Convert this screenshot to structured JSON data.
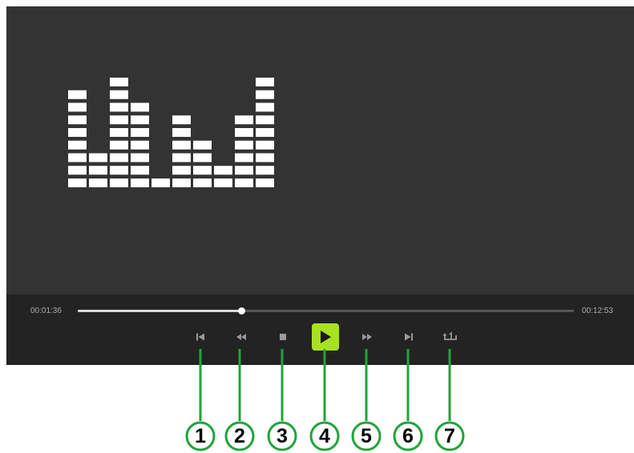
{
  "player": {
    "elapsed": "00:01:36",
    "total": "00:12:53",
    "progress": 0.33,
    "accent_color": "#a8e022",
    "background_color": "#333333",
    "control_bar_color": "#232323"
  },
  "equalizer": {
    "bar_levels": [
      8,
      3,
      9,
      7,
      1,
      6,
      4,
      2,
      6,
      9
    ]
  },
  "controls": [
    {
      "id": "1",
      "name": "skip-previous",
      "icon": "skip-previous-icon"
    },
    {
      "id": "2",
      "name": "rewind",
      "icon": "rewind-icon"
    },
    {
      "id": "3",
      "name": "stop",
      "icon": "stop-icon"
    },
    {
      "id": "4",
      "name": "play",
      "icon": "play-icon"
    },
    {
      "id": "5",
      "name": "fast-forward",
      "icon": "fast-forward-icon"
    },
    {
      "id": "6",
      "name": "skip-next",
      "icon": "skip-next-icon"
    },
    {
      "id": "7",
      "name": "repeat-one",
      "icon": "repeat-one-icon"
    }
  ],
  "callouts": {
    "line_color": "#21a33a",
    "labels": [
      "1",
      "2",
      "3",
      "4",
      "5",
      "6",
      "7"
    ]
  }
}
